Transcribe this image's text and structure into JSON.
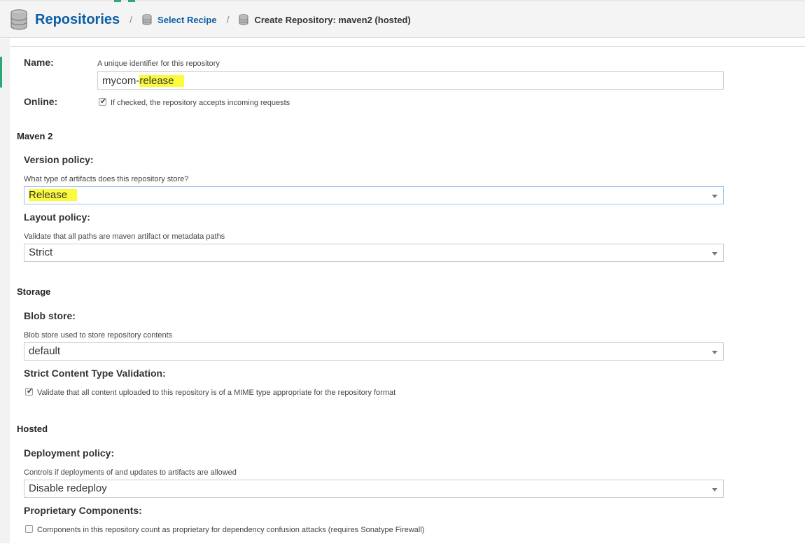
{
  "header": {
    "title": "Repositories",
    "separator": "/",
    "crumb_recipe": "Select Recipe",
    "crumb_current": "Create Repository: maven2 (hosted)"
  },
  "form": {
    "name": {
      "label": "Name:",
      "hint": "A unique identifier for this repository",
      "value_prefix": "mycom-",
      "value_highlight": "release"
    },
    "online": {
      "label": "Online:",
      "checked": true,
      "text": "If checked, the repository accepts incoming requests"
    },
    "maven_section": "Maven 2",
    "version_policy": {
      "label": "Version policy:",
      "hint": "What type of artifacts does this repository store?",
      "value": "Release"
    },
    "layout_policy": {
      "label": "Layout policy:",
      "hint": "Validate that all paths are maven artifact or metadata paths",
      "value": "Strict"
    },
    "storage_section": "Storage",
    "blob_store": {
      "label": "Blob store:",
      "hint": "Blob store used to store repository contents",
      "value": "default"
    },
    "strict_content": {
      "label": "Strict Content Type Validation:",
      "checked": true,
      "text": "Validate that all content uploaded to this repository is of a MIME type appropriate for the repository format"
    },
    "hosted_section": "Hosted",
    "deployment_policy": {
      "label": "Deployment policy:",
      "hint": "Controls if deployments of and updates to artifacts are allowed",
      "value": "Disable redeploy"
    },
    "proprietary": {
      "label": "Proprietary Components:",
      "checked": false,
      "text": "Components in this repository count as proprietary for dependency confusion attacks (requires Sonatype Firewall)"
    }
  },
  "colors": {
    "accent_blue": "#0b5fa5",
    "accent_green": "#2aa876",
    "highlight": "#fbfb3c"
  },
  "icons": {
    "title_icon": "database-icon",
    "crumb_icon": "database-icon",
    "dropdown_icon": "chevron-down-icon",
    "check_icon": "checkmark-icon"
  }
}
